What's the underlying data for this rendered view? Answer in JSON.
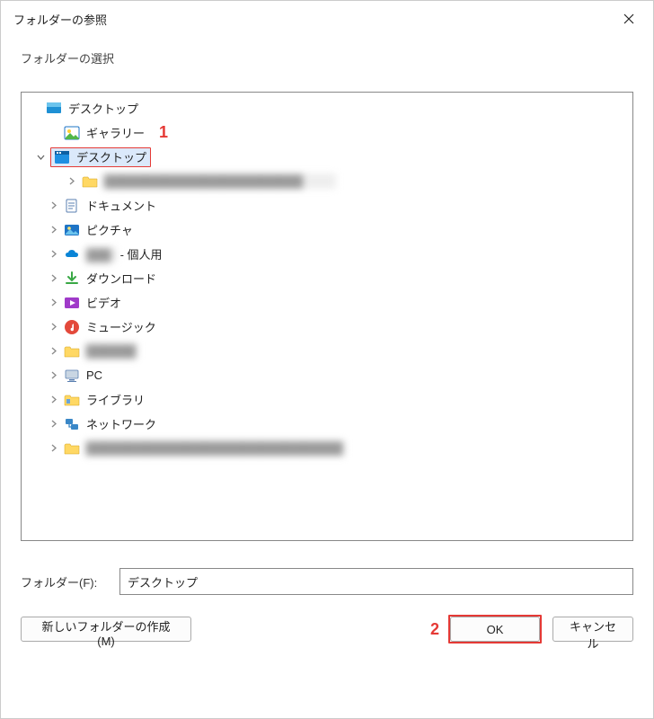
{
  "title": "フォルダーの参照",
  "subtitle": "フォルダーの選択",
  "annotations": {
    "one": "1",
    "two": "2"
  },
  "tree": {
    "root": {
      "label": "デスクトップ",
      "icon": "desktop-blue"
    },
    "gallery": {
      "label": "ギャラリー",
      "icon": "gallery"
    },
    "desktop2": {
      "label": "デスクトップ",
      "icon": "desktop-win"
    },
    "subfolder_blur": {
      "label": "████████████████████████",
      "icon": "folder"
    },
    "documents": {
      "label": "ドキュメント",
      "icon": "documents"
    },
    "pictures": {
      "label": "ピクチャ",
      "icon": "pictures"
    },
    "onedrive": {
      "label_prefix": "███",
      "label_suffix": " - 個人用",
      "icon": "onedrive"
    },
    "downloads": {
      "label": "ダウンロード",
      "icon": "downloads"
    },
    "videos": {
      "label": "ビデオ",
      "icon": "videos"
    },
    "music": {
      "label": "ミュージック",
      "icon": "music"
    },
    "blur_item": {
      "label": "██████",
      "icon": "folder"
    },
    "pc": {
      "label": "PC",
      "icon": "pc"
    },
    "libraries": {
      "label": "ライブラリ",
      "icon": "libraries"
    },
    "network": {
      "label": "ネットワーク",
      "icon": "network"
    },
    "blur_long": {
      "label": "███████████████████████████████",
      "icon": "folder"
    }
  },
  "folder_label": "フォルダー(F):",
  "folder_value": "デスクトップ",
  "buttons": {
    "new_folder": "新しいフォルダーの作成(M)",
    "ok": "OK",
    "cancel": "キャンセル"
  }
}
